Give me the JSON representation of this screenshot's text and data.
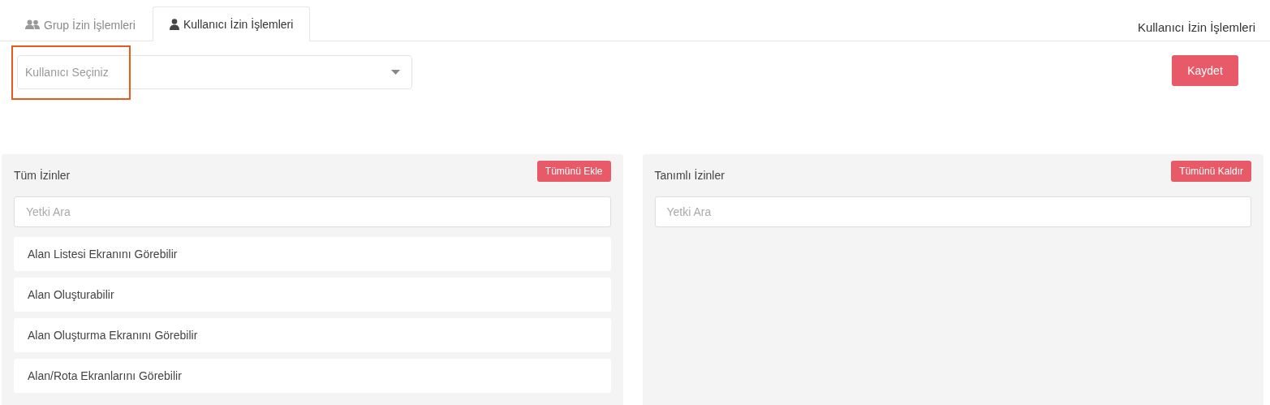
{
  "tabs": [
    {
      "label": "Grup İzin İşlemleri",
      "kind": "group",
      "selected": false
    },
    {
      "label": "Kullanıcı İzin İşlemleri",
      "kind": "user",
      "selected": true
    }
  ],
  "page_title": "Kullanıcı İzin İşlemleri",
  "user_select": {
    "placeholder": "Kullanıcı Seçiniz",
    "highlighted": true
  },
  "save_button": "Kaydet",
  "panels": [
    {
      "title": "Tüm İzinler",
      "button": "Tümünü Ekle",
      "search": {
        "placeholder": "Yetki Ara"
      },
      "items": [
        "Alan Listesi Ekranını Görebilir",
        "Alan Oluşturabilir",
        "Alan Oluşturma Ekranını Görebilir",
        "Alan/Rota Ekranlarını Görebilir"
      ]
    },
    {
      "title": "Tanımlı İzinler",
      "button": "Tümünü Kaldır",
      "search": {
        "placeholder": "Yetki Ara"
      }
    }
  ]
}
